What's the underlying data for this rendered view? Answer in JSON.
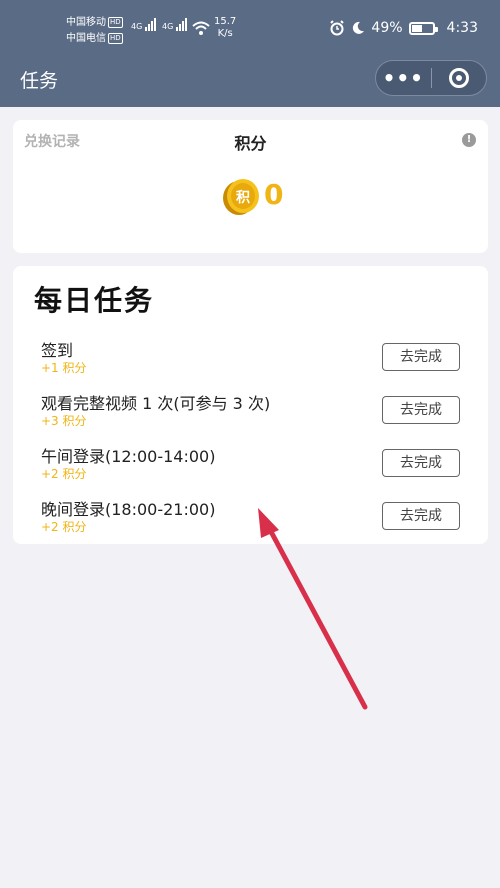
{
  "status_bar": {
    "carrier1": "中国移动",
    "carrier2": "中国电信",
    "hd_badge": "HD",
    "net1": "4G",
    "net2": "4G",
    "speed_value": "15.7",
    "speed_unit": "K/s",
    "battery": "49%",
    "time": "4:33"
  },
  "header": {
    "title": "任务",
    "more_glyph": "•••"
  },
  "points_card": {
    "records_link": "兑换记录",
    "title": "积分",
    "info_glyph": "!",
    "coin_glyph": "积",
    "value": "0"
  },
  "daily_tasks": {
    "heading": "每日任务",
    "button_label": "去完成",
    "items": [
      {
        "name": "签到",
        "reward": "+1 积分"
      },
      {
        "name": "观看完整视频 1 次(可参与 3 次)",
        "reward": "+3 积分"
      },
      {
        "name": "午间登录(12:00-14:00)",
        "reward": "+2 积分"
      },
      {
        "name": "晚间登录(18:00-21:00)",
        "reward": "+2 积分"
      }
    ]
  },
  "colors": {
    "header_bg": "#5a6b85",
    "page_bg": "#f2f2f6",
    "accent_gold": "#f0b414",
    "annotation_arrow": "#d8304a"
  }
}
